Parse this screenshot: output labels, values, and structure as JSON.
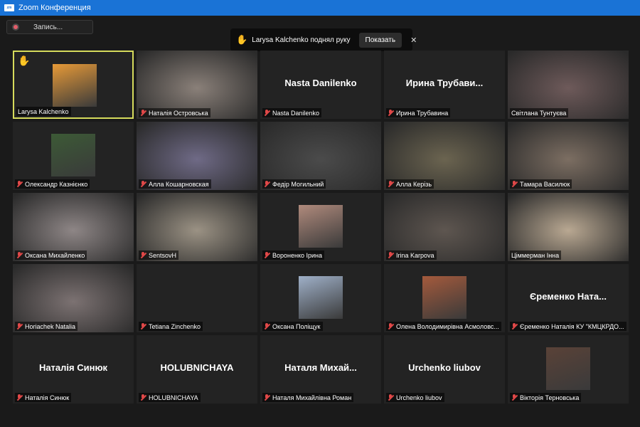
{
  "window": {
    "title": "Zoom Конференция",
    "logo": "zm"
  },
  "record": {
    "label": "Запись..."
  },
  "notification": {
    "text": "Larysa Kalchenko поднял руку",
    "show_label": "Показать",
    "close": "✕",
    "hand": "✋"
  },
  "tiles": [
    {
      "label": "Larysa Kalchenko",
      "muted": false,
      "video": "thumb",
      "hand": "✋",
      "active": true,
      "bg": "#e79a38"
    },
    {
      "label": "Наталія Островська",
      "muted": true,
      "video": "full",
      "bg": "#8a8079"
    },
    {
      "label": "Nasta Danilenko",
      "muted": true,
      "video": "none",
      "big": "Nasta Danilenko"
    },
    {
      "label": "Ирина Трубавина",
      "muted": true,
      "video": "none",
      "big": "Ирина  Трубави..."
    },
    {
      "label": "Світлана Тунтуєва",
      "muted": false,
      "video": "full",
      "bg": "#6e5a5a"
    },
    {
      "label": "Олександр Казнієнко",
      "muted": true,
      "video": "thumb",
      "bg": "#3c5a36"
    },
    {
      "label": "Алла Кошарновская",
      "muted": true,
      "video": "full",
      "bg": "#6f6a86"
    },
    {
      "label": "Федір Могильний",
      "muted": true,
      "video": "full",
      "bg": "#4b4b4b"
    },
    {
      "label": "Алла Керізь",
      "muted": true,
      "video": "full",
      "bg": "#6b6450"
    },
    {
      "label": "Тамара Василюк",
      "muted": true,
      "video": "full",
      "bg": "#7c6e62"
    },
    {
      "label": "Оксана Михайленко",
      "muted": true,
      "video": "full",
      "bg": "#8e8686"
    },
    {
      "label": "SentsovH",
      "muted": true,
      "video": "full",
      "bg": "#9b9284"
    },
    {
      "label": "Вороненко Ірина",
      "muted": true,
      "video": "thumb",
      "bg": "#b08a7c"
    },
    {
      "label": "Irina Karpova",
      "muted": true,
      "video": "full",
      "bg": "#5e5650"
    },
    {
      "label": "Ціммерман Інна",
      "muted": false,
      "video": "full",
      "bg": "#b9a892"
    },
    {
      "label": "Horiachek Natalia",
      "muted": true,
      "video": "full",
      "bg": "#7c7272"
    },
    {
      "label": "Tetiana Zinchenko",
      "muted": true,
      "video": "none",
      "big": ""
    },
    {
      "label": "Оксана Поліщук",
      "muted": true,
      "video": "thumb",
      "bg": "#9fb0c8"
    },
    {
      "label": "Олена Володимирівна Асмоловс...",
      "muted": true,
      "video": "thumb",
      "bg": "#a45a3c"
    },
    {
      "label": "Єременко Наталія КУ \"КМЦКРДО...",
      "muted": true,
      "video": "none",
      "big": "Єременко  Ната..."
    },
    {
      "label": "Наталія Синюк",
      "muted": true,
      "video": "none",
      "big": "Наталія Синюк"
    },
    {
      "label": "HOLUBNICHAYA",
      "muted": true,
      "video": "none",
      "big": "HOLUBNICHAYA"
    },
    {
      "label": "Наталя Михайлівна Роман",
      "muted": true,
      "video": "none",
      "big": "Наталя  Михай..."
    },
    {
      "label": "Urchenko liubov",
      "muted": true,
      "video": "none",
      "big": "Urchenko liubov"
    },
    {
      "label": "Вікторія Терновська",
      "muted": true,
      "video": "thumb",
      "bg": "#5a4238"
    }
  ]
}
